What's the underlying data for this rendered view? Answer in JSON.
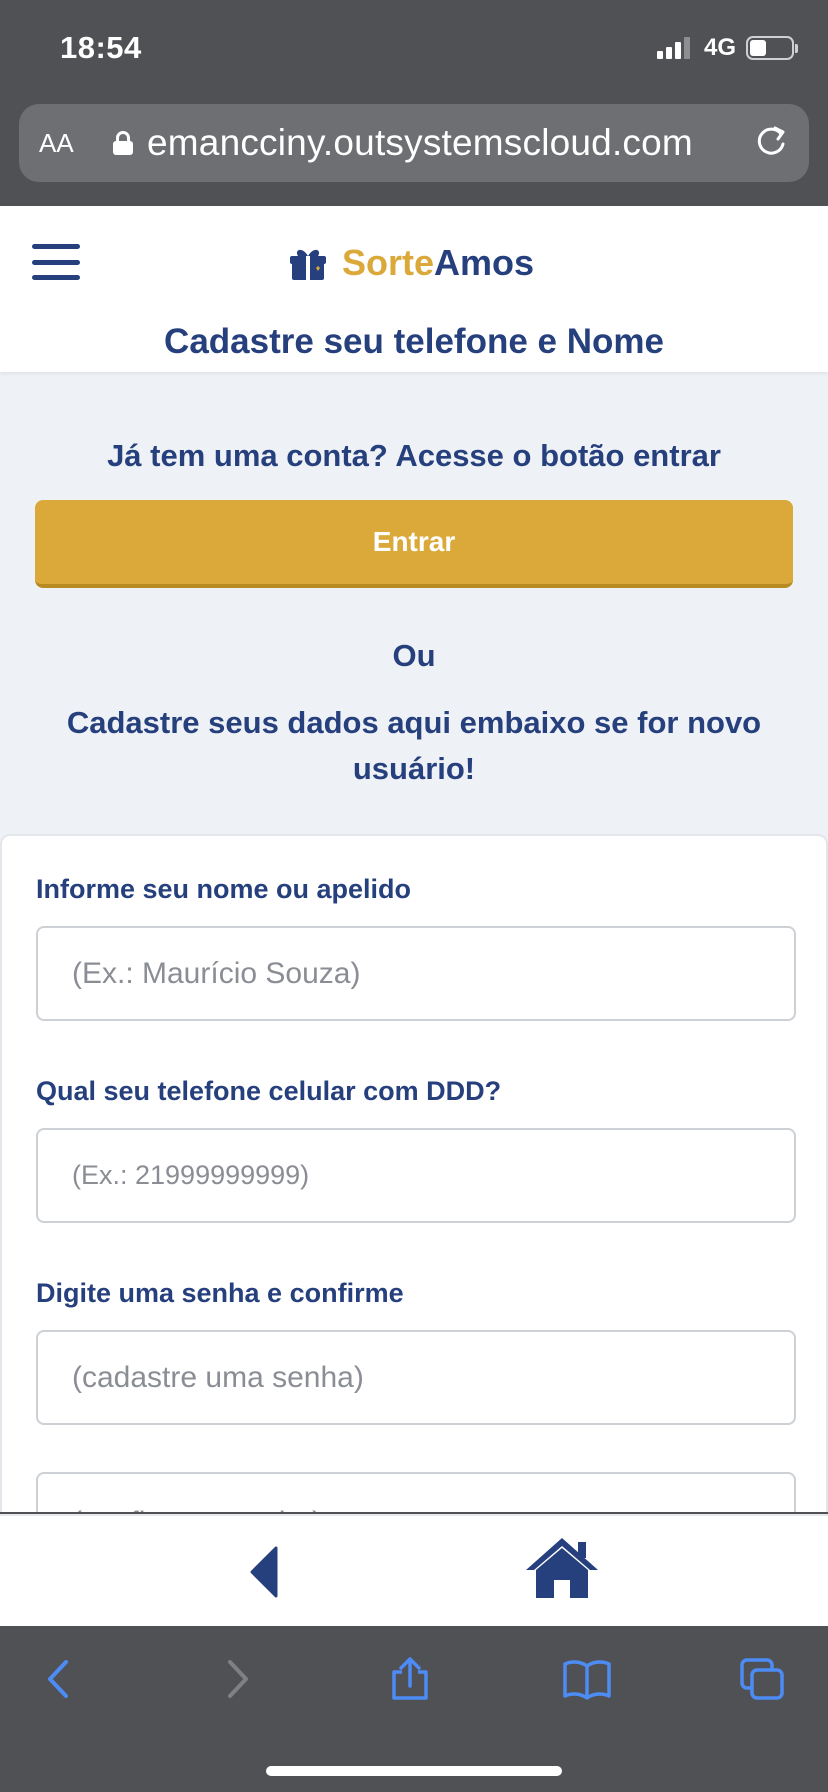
{
  "status_bar": {
    "time": "18:54",
    "network": "4G"
  },
  "browser": {
    "text_size_label": "AA",
    "url": "emancciny.outsystemscloud.com"
  },
  "header": {
    "brand_part1": "Sorte",
    "brand_part2": "Amos",
    "page_title": "Cadastre seu telefone e Nome"
  },
  "main": {
    "login_prompt": "Já tem uma conta? Acesse o botão entrar",
    "login_button": "Entrar",
    "or_label": "Ou",
    "register_prompt": "Cadastre seus dados aqui embaixo se for novo usuário!"
  },
  "form": {
    "name_label": "Informe seu nome ou apelido",
    "name_placeholder": "(Ex.: Maurício Souza)",
    "phone_label": "Qual seu telefone celular com DDD?",
    "phone_placeholder": "(Ex.: 21999999999)",
    "password_label": "Digite uma senha e confirme",
    "password_placeholder": "(cadastre uma senha)",
    "confirm_placeholder": "(confirme a senha)"
  },
  "colors": {
    "primary": "#263f7d",
    "accent": "#dba93a",
    "background": "#eef1f5"
  },
  "icons": {
    "menu": "hamburger-icon",
    "brand": "gift-icon",
    "back": "back-arrow-icon",
    "home": "home-icon"
  }
}
